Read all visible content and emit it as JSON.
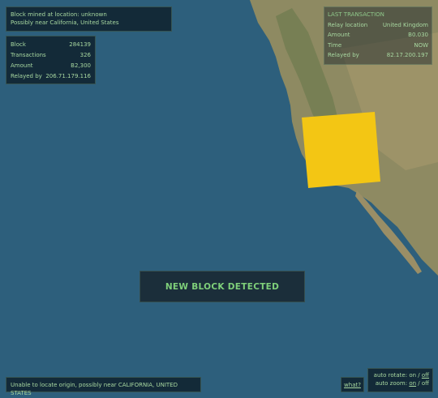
{
  "location_panel": {
    "line1": "Block mined at location: unknown",
    "line2": "Possibly near California, United States"
  },
  "block_panel": {
    "rows": [
      {
        "label": "Block",
        "value": "284139"
      },
      {
        "label": "Transactions",
        "value": "326"
      },
      {
        "label": "Amount",
        "value": "B2,300"
      },
      {
        "label": "Relayed by",
        "value": "206.71.179.116"
      }
    ]
  },
  "last_transaction": {
    "title": "LAST TRANSACTION",
    "rows": [
      {
        "label": "Relay location",
        "value": "United Kingdom"
      },
      {
        "label": "Amount",
        "value": "B0.030"
      },
      {
        "label": "Time",
        "value": "NOW"
      },
      {
        "label": "Relayed by",
        "value": "82.17.200.197"
      }
    ]
  },
  "banner": {
    "text": "NEW BLOCK DETECTED"
  },
  "status": {
    "text": "Unable to locate origin, possibly near CALIFORNIA, UNITED STATES"
  },
  "help": {
    "text": "what?"
  },
  "controls": {
    "rotate_label": "auto rotate:",
    "rotate_on": "on",
    "rotate_sep": "/",
    "rotate_off": "off",
    "zoom_label": "auto zoom:",
    "zoom_on": "on",
    "zoom_sep": "/",
    "zoom_off": "off"
  },
  "colors": {
    "ocean": "#2d5f7c",
    "marker": "#f3c614",
    "accent": "#7fd07a"
  }
}
